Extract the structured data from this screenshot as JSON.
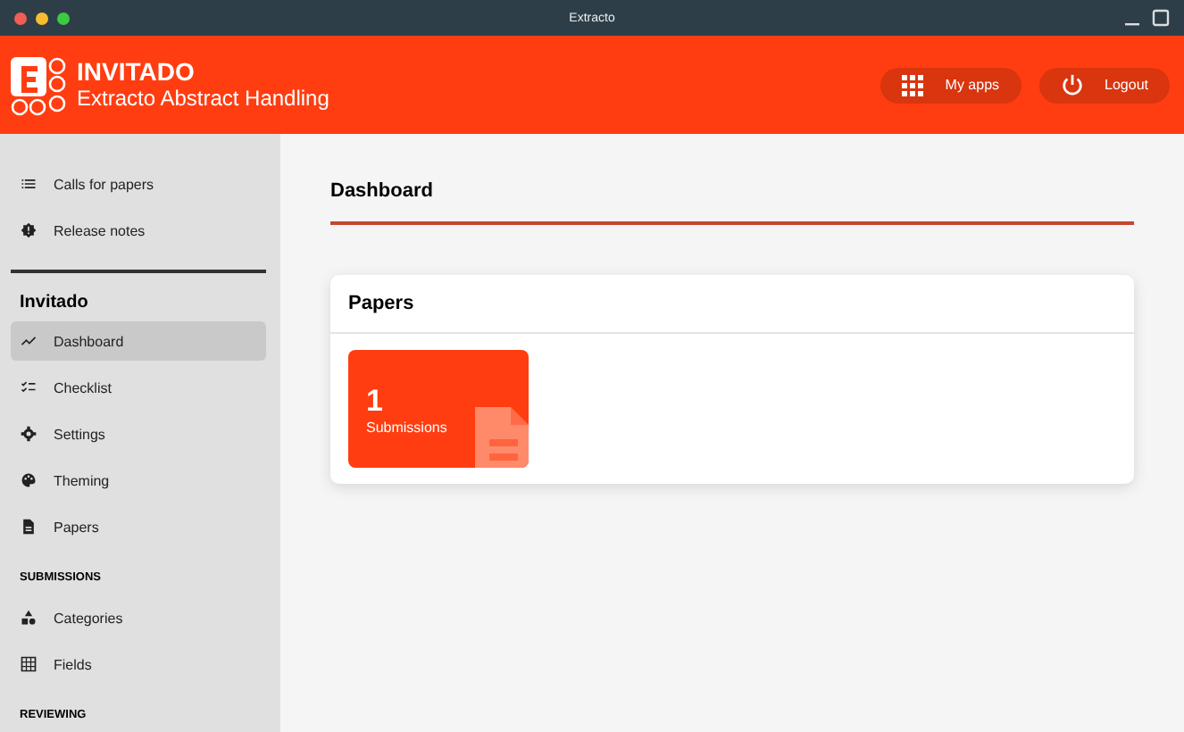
{
  "window": {
    "title": "Extracto"
  },
  "header": {
    "title": "INVITADO",
    "subtitle": "Extracto Abstract Handling",
    "buttons": [
      {
        "kind": "apps",
        "label": "My apps"
      },
      {
        "kind": "logout",
        "label": "Logout"
      }
    ]
  },
  "sidebar": {
    "top_items": [
      {
        "kind": "list",
        "label": "Calls for papers",
        "selected": false
      },
      {
        "kind": "alert",
        "label": "Release notes",
        "selected": false
      }
    ],
    "section_title": "Invitado",
    "items": [
      {
        "kind": "chart",
        "label": "Dashboard",
        "selected": true
      },
      {
        "kind": "checklist",
        "label": "Checklist",
        "selected": false
      },
      {
        "kind": "gear",
        "label": "Settings",
        "selected": false
      },
      {
        "kind": "palette",
        "label": "Theming",
        "selected": false
      },
      {
        "kind": "doc",
        "label": "Papers",
        "selected": false
      }
    ],
    "groups": [
      {
        "title": "SUBMISSIONS",
        "items": [
          {
            "kind": "shapes",
            "label": "Categories",
            "selected": false
          },
          {
            "kind": "table",
            "label": "Fields",
            "selected": false
          }
        ]
      },
      {
        "title": "REVIEWING"
      }
    ]
  },
  "main": {
    "title": "Dashboard",
    "card": {
      "title": "Papers",
      "tiles": [
        {
          "count": "1",
          "label": "Submissions"
        }
      ]
    }
  }
}
